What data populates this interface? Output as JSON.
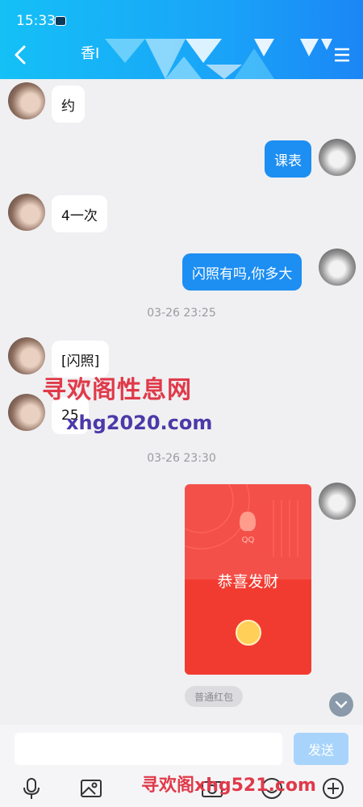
{
  "status_bar": {
    "time": "15:33"
  },
  "header": {
    "title": "香Ⅰ",
    "back_icon": "back-icon",
    "menu_icon": "menu-icon"
  },
  "messages": [
    {
      "side": "in",
      "text": "约"
    },
    {
      "side": "out",
      "text": "课表"
    },
    {
      "side": "in",
      "text": "4一次"
    },
    {
      "side": "out",
      "text": "闪照有吗,你多大"
    },
    {
      "side": "in",
      "text": "[闪照]"
    },
    {
      "side": "in",
      "text": "25"
    }
  ],
  "separators": [
    "03-26  23:25",
    "03-26  23:30"
  ],
  "red_packet": {
    "brand": "QQ",
    "title": "恭喜发财",
    "badge": "普通红包"
  },
  "watermark": {
    "cn": "寻欢阁性息网",
    "url": "xhg2020.com",
    "bottom": "寻欢阁xhg521.com"
  },
  "input": {
    "placeholder": "",
    "send_label": "发送"
  },
  "colors": {
    "header": "#1aa4f8",
    "bubble_out": "#1d8ef2",
    "red_packet": "#f23b30",
    "send": "#a8d4fb"
  }
}
